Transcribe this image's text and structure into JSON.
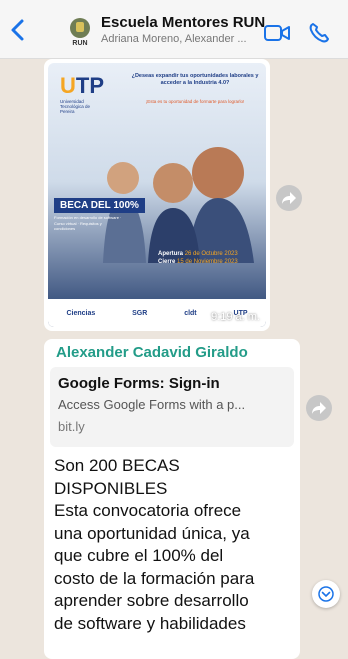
{
  "header": {
    "title": "Escuela Mentores RUN",
    "subtitle": "Adriana Moreno, Alexander ...",
    "avatar_text": "RUN"
  },
  "image_message": {
    "poster": {
      "logo": "UTP",
      "logo_sub": "Universidad Tecnológica de Pereira",
      "headline": "¿Deseas expandir tus oportunidades laborales y acceder a la Industria 4.0?",
      "subline": "¡Esta es tu oportunidad de formarte para lograrlo!",
      "beca": "BECA DEL 100%",
      "info": "Formación en desarrollo de software · Curso virtual · Requisitos y condiciones",
      "apertura_label": "Apertura",
      "apertura_date": "26 de Octubre 2023",
      "cierre_label": "Cierre",
      "cierre_date": "15 de Noviembre 2023",
      "footer": [
        "Ciencias",
        "SGR",
        "cldt",
        "UTP"
      ]
    },
    "time": "9:19 a. m."
  },
  "text_message": {
    "sender": "Alexander  Cadavid Giraldo",
    "link_preview": {
      "title": "Google Forms: Sign-in",
      "description": "Access Google Forms with a p...",
      "domain": "bit.ly"
    },
    "body": "Son 200 BECAS\nDISPONIBLES\nEsta convocatoria ofrece\nuna oportunidad única, ya\nque cubre el 100% del\ncosto de la formación para\naprender sobre desarrollo\nde software y habilidades"
  },
  "colors": {
    "accent": "#1a73e8",
    "sender": "#239c88",
    "chat_bg": "#ece5dd"
  },
  "icons": [
    "chevron-left-icon",
    "video-call-icon",
    "phone-icon",
    "forward-icon",
    "chevron-down-icon"
  ]
}
